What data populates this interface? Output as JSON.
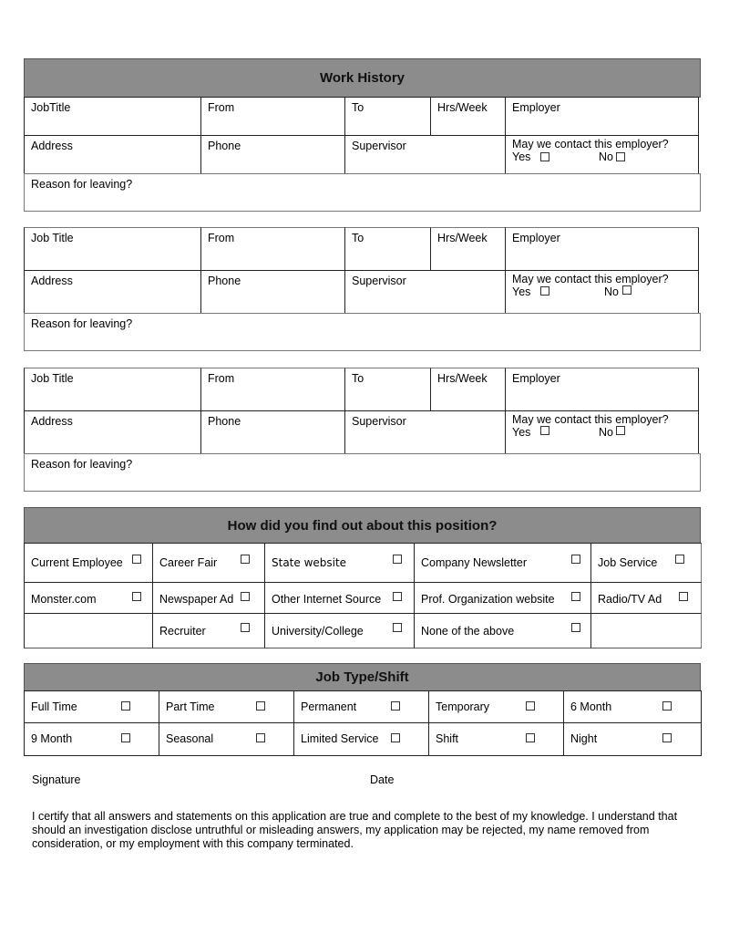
{
  "work_history": {
    "title": "Work History",
    "entries": [
      {
        "job_title": "JobTitle",
        "from": "From",
        "to": "To",
        "hrs_week": "Hrs/Week",
        "employer": "Employer",
        "address": "Address",
        "phone": "Phone",
        "supervisor": "Supervisor",
        "contact_question": "May we contact this employer?",
        "yes": "Yes",
        "no": "No",
        "reason": "Reason for leaving?"
      },
      {
        "job_title": "Job Title",
        "from": "From",
        "to": "To",
        "hrs_week": "Hrs/Week",
        "employer": "Employer",
        "address": "Address",
        "phone": "Phone",
        "supervisor": "Supervisor",
        "contact_question": "May we contact this employer?",
        "yes": "Yes",
        "no": "No",
        "reason": "Reason for leaving?"
      },
      {
        "job_title": "Job Title",
        "from": "From",
        "to": "To",
        "hrs_week": "Hrs/Week",
        "employer": "Employer",
        "address": "Address",
        "phone": "Phone",
        "supervisor": "Supervisor",
        "contact_question": "May we contact this employer?",
        "yes": "Yes",
        "no": "No",
        "reason": "Reason for leaving?"
      }
    ]
  },
  "source": {
    "title": "How did you find out about this position?",
    "rows": [
      [
        "Current Employee",
        "Career Fair",
        "State website",
        "Company Newsletter",
        "Job Service"
      ],
      [
        "Monster.com",
        "Newspaper Ad",
        "Other Internet Source",
        "Prof. Organization website",
        "Radio/TV Ad"
      ],
      [
        "",
        "Recruiter",
        "University/College",
        "None of the above",
        ""
      ]
    ]
  },
  "job_type": {
    "title": "Job Type/Shift",
    "rows": [
      [
        "Full Time",
        "Part Time",
        "Permanent",
        "Temporary",
        "6 Month"
      ],
      [
        "9 Month",
        "Seasonal",
        "Limited Service",
        "Shift",
        "Night"
      ]
    ]
  },
  "signature": {
    "signature_label": "Signature",
    "date_label": "Date"
  },
  "certification": "I certify that all answers and statements on this application are true and complete to the best of my knowledge. I understand that should an investigation disclose untruthful or misleading answers, my application may be rejected, my name removed from consideration, or my employment with this company terminated."
}
